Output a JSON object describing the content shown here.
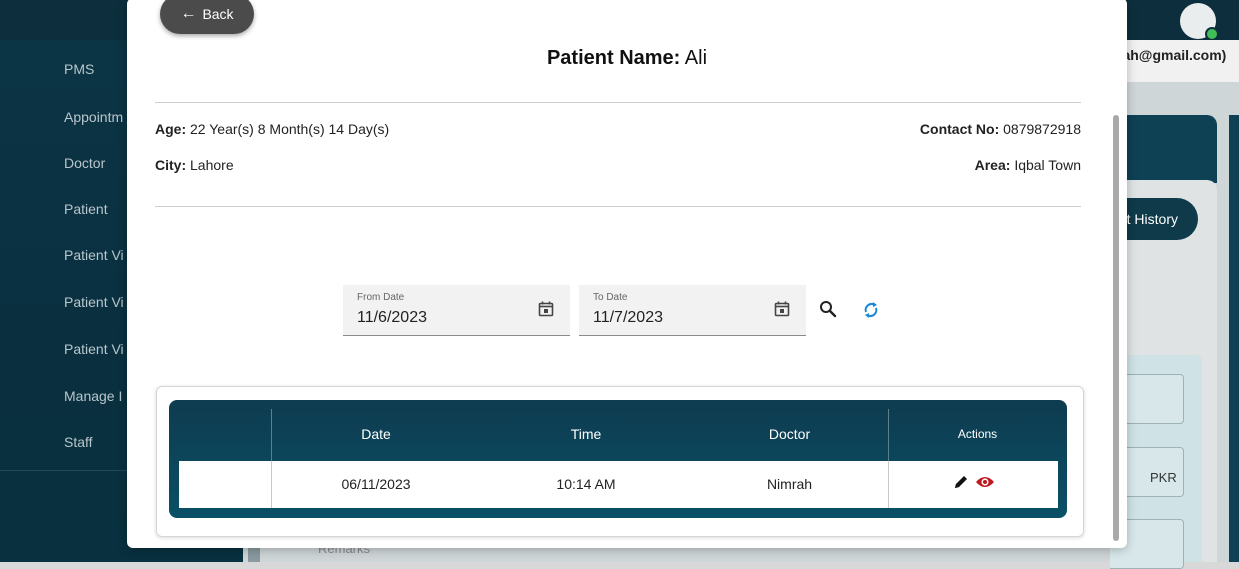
{
  "sidebar": {
    "items": [
      {
        "label": "PMS"
      },
      {
        "label": "Appointm"
      },
      {
        "label": "Doctor"
      },
      {
        "label": "Patient"
      },
      {
        "label": "Patient Vi"
      },
      {
        "label": "Patient Vi"
      },
      {
        "label": "Patient Vi"
      },
      {
        "label": "Manage I"
      },
      {
        "label": "Staff"
      }
    ]
  },
  "header": {
    "email_fragment": "rah@gmail.com)"
  },
  "background": {
    "history_button": "t History",
    "currency_label": "PKR",
    "remarks_label": "Remarks"
  },
  "modal": {
    "back_label": "Back",
    "title_prefix": "Patient Name:",
    "patient_name": "Ali",
    "age_label": "Age:",
    "age_value": "22 Year(s) 8 Month(s) 14 Day(s)",
    "contact_label": "Contact No:",
    "contact_value": "0879872918",
    "city_label": "City:",
    "city_value": "Lahore",
    "area_label": "Area:",
    "area_value": "Iqbal Town",
    "from_date_label": "From Date",
    "from_date_value": "11/6/2023",
    "to_date_label": "To Date",
    "to_date_value": "11/7/2023",
    "table": {
      "headers": [
        "",
        "Date",
        "Time",
        "Doctor",
        "Actions"
      ],
      "rows": [
        {
          "date": "06/11/2023",
          "time": "10:14 AM",
          "doctor": "Nimrah"
        }
      ]
    }
  },
  "colors": {
    "sidebar_bg": "#0b3444",
    "table_header": "#0e3b4f",
    "back_button": "#4b4b4b"
  }
}
